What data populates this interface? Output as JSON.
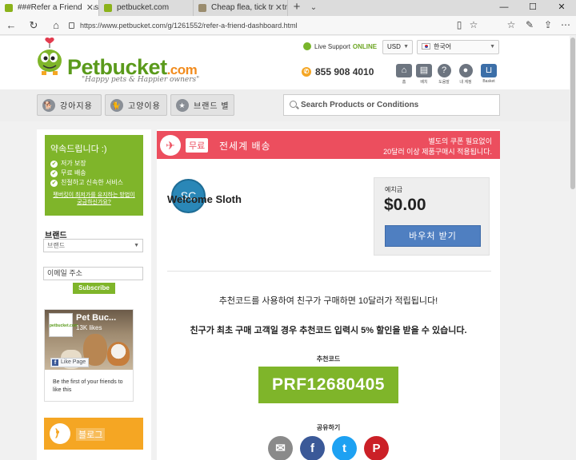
{
  "browser": {
    "tabs": [
      {
        "label": "###Refer a Friend Dash",
        "active": true
      },
      {
        "label": "petbucket.com",
        "active": false
      },
      {
        "label": "Cheap flea, tick treatments,",
        "active": false
      }
    ],
    "new_tab": "+",
    "more_tabs": "⌄",
    "url": "https://www.petbucket.com/g/1261552/refer-a-friend-dashboard.html",
    "window_controls": [
      "—",
      "☐",
      "✕"
    ],
    "tab_close": "✕"
  },
  "header": {
    "logo_pet": "Pet",
    "logo_bucket": "bucket",
    "logo_com": ".com",
    "tagline": "\"Happy pets & Happier owners\"",
    "live_support": "Live Support",
    "online": "ONLINE",
    "currency": "USD",
    "language": "한국어",
    "phone": "855 908 4010",
    "icons": [
      {
        "name": "home-icon",
        "glyph": "⌂",
        "label": "홈"
      },
      {
        "name": "document-icon",
        "glyph": "▤",
        "label": "배치"
      },
      {
        "name": "help-icon",
        "glyph": "?",
        "label": "도움말"
      },
      {
        "name": "user-icon",
        "glyph": "●",
        "label": "내 계정"
      },
      {
        "name": "basket-icon",
        "glyph": "⊔",
        "label": "Basket"
      }
    ]
  },
  "categories": {
    "dog": "강아지용",
    "cat": "고양이용",
    "brand": "브랜드 별",
    "search_placeholder": "Search Products or Conditions"
  },
  "sidebar": {
    "promise_title": "약속드립니다 :)",
    "promise_items": [
      "저가 보장",
      "무료 배송",
      "친절하고 신속한 서비스"
    ],
    "promise_link": "펫버킷이 최저가를 유지하는 방법이 궁금하신가요?",
    "brand_heading": "브랜드",
    "brand_select": "브랜드",
    "email_placeholder": "이메일 주소",
    "subscribe": "Subscribe",
    "fb": {
      "title": "Pet Buc...",
      "likes": "13K likes",
      "like_btn": "Like Page",
      "note": "Be the first of your friends to like this",
      "logo": "petbucket.com"
    },
    "blog": "블로그"
  },
  "banner": {
    "free_tag": "무료",
    "shipping": "전세계 배송",
    "right_line1": "별도의 쿠폰 필요없이",
    "right_line2": "20달러 이상 제품구매시 적용됩니다."
  },
  "account": {
    "avatar_initials": "SC",
    "welcome": "Welcome Sloth",
    "balance_label": "예치금",
    "balance_amount": "$0.00",
    "voucher_button": "바우처 받기"
  },
  "referral": {
    "message1": "추천코드를 사용하여 친구가 구매하면 10달러가 적립됩니다!",
    "message2": "친구가 최초 구매 고객일 경우 추천코드 입력시 5% 할인을 받을 수 있습니다.",
    "code_label": "추천코드",
    "code": "PRF12680405",
    "share_label": "공유하기",
    "share": [
      {
        "name": "email-share-icon",
        "glyph": "✉",
        "color": "#8a8a8a"
      },
      {
        "name": "facebook-share-icon",
        "glyph": "f",
        "color": "#3b5998"
      },
      {
        "name": "twitter-share-icon",
        "glyph": "t",
        "color": "#1da1f2"
      },
      {
        "name": "pinterest-share-icon",
        "glyph": "P",
        "color": "#cb2027"
      }
    ]
  },
  "colors": {
    "brand_green": "#7fb52a",
    "banner_red": "#ec4e5e",
    "voucher_blue": "#4f7fc1",
    "blog_orange": "#f5a623"
  }
}
